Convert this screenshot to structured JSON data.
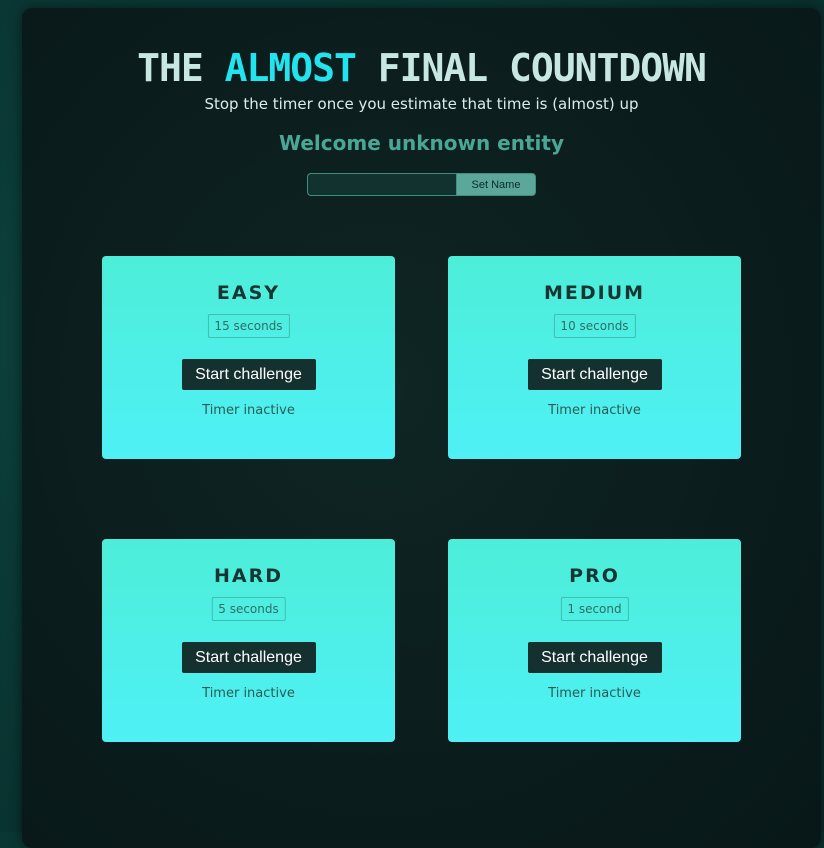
{
  "header": {
    "title_part1": "THE ",
    "title_accent": "ALMOST",
    "title_part2": " FINAL COUNTDOWN",
    "subtitle": "Stop the timer once you estimate that time is (almost) up",
    "welcome": "Welcome unknown entity"
  },
  "name_form": {
    "input_value": "",
    "button_label": "Set Name"
  },
  "challenges": [
    {
      "title": "EASY",
      "duration": "15 seconds",
      "button_label": "Start challenge",
      "status": "Timer inactive"
    },
    {
      "title": "MEDIUM",
      "duration": "10 seconds",
      "button_label": "Start challenge",
      "status": "Timer inactive"
    },
    {
      "title": "HARD",
      "duration": "5 seconds",
      "button_label": "Start challenge",
      "status": "Timer inactive"
    },
    {
      "title": "PRO",
      "duration": "1 second",
      "button_label": "Start challenge",
      "status": "Timer inactive"
    }
  ],
  "colors": {
    "accent": "#22e4ef",
    "card_top": "#4deed8",
    "card_bottom": "#4ff0f6",
    "button_dark": "#15312f",
    "welcome_text": "#4ba795"
  }
}
